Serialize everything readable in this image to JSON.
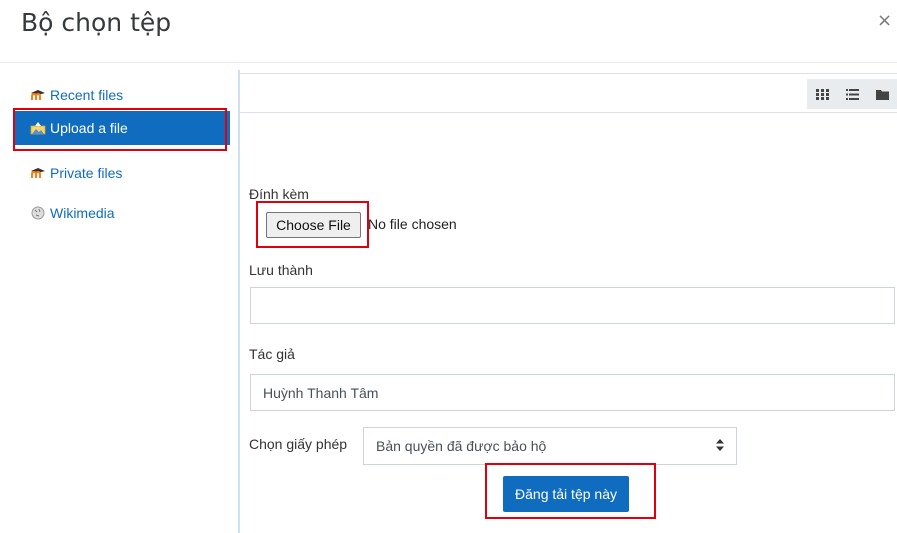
{
  "dialog": {
    "title": "Bộ chọn tệp",
    "close_symbol": "×"
  },
  "sidebar": {
    "items": [
      {
        "label": "Recent files",
        "icon": "moodle-icon"
      },
      {
        "label": "Upload a file",
        "icon": "upload-icon",
        "active": true
      },
      {
        "label": "Private files",
        "icon": "moodle-icon"
      },
      {
        "label": "Wikimedia",
        "icon": "wikimedia-icon"
      }
    ]
  },
  "toolbar": {
    "views": [
      "grid-view-icon",
      "list-view-icon",
      "folder-view-icon"
    ]
  },
  "form": {
    "attachment_label": "Đính kèm",
    "choose_file_label": "Choose File",
    "no_file_text": "No file chosen",
    "save_as_label": "Lưu thành",
    "save_as_value": "",
    "author_label": "Tác giả",
    "author_value": "Huỳnh Thanh Tâm",
    "license_label": "Chọn giấy phép",
    "license_value": "Bản quyền đã được bảo hộ",
    "submit_label": "Đăng tải tệp này"
  },
  "colors": {
    "accent": "#0f6cbf",
    "highlight_box": "#e0000b",
    "moodle_orange": "#f98012"
  }
}
